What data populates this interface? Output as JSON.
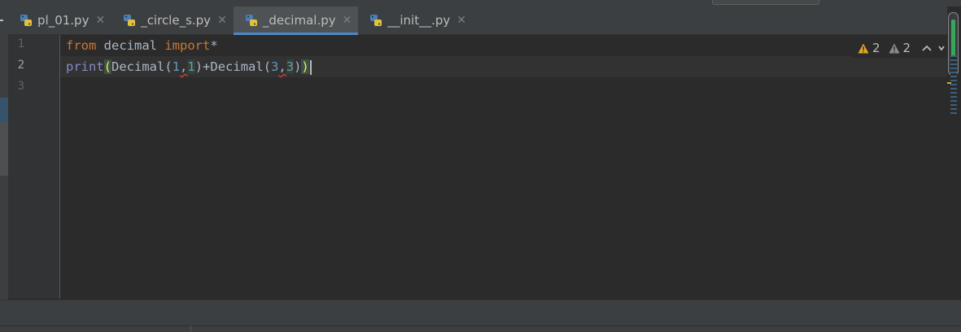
{
  "tabs": [
    {
      "label": "pl_01.py",
      "active": false
    },
    {
      "label": "_circle_s.py",
      "active": false
    },
    {
      "label": "_decimal.py",
      "active": true
    },
    {
      "label": "__init__.py",
      "active": false
    }
  ],
  "close_glyph": "✕",
  "gutter": {
    "line_numbers": [
      "1",
      "2",
      "3"
    ],
    "current_line": "2"
  },
  "code": {
    "line1": {
      "kw1": "from",
      "mod": " decimal ",
      "kw2": "import",
      "star": "*"
    },
    "line2": {
      "fn": "print",
      "open": "(",
      "cls1": "Decimal(",
      "n1": "1",
      "c1": ",",
      "n2": "1",
      "mid": ")+Decimal(",
      "n3": "3",
      "c2": ",",
      "n4": "3",
      "close1": ")",
      "close2": ")"
    }
  },
  "inspections": {
    "warnings_count": "2",
    "weak_warnings_count": "2",
    "prev_icon": "chevron-up-icon",
    "next_icon": "chevron-down-icon"
  },
  "colors": {
    "keyword": "#cc7832",
    "builtin": "#8888c6",
    "number": "#6897bb",
    "text": "#a9b7c6",
    "active_tab_underline": "#4a88c7",
    "warning": "#e0a526"
  }
}
